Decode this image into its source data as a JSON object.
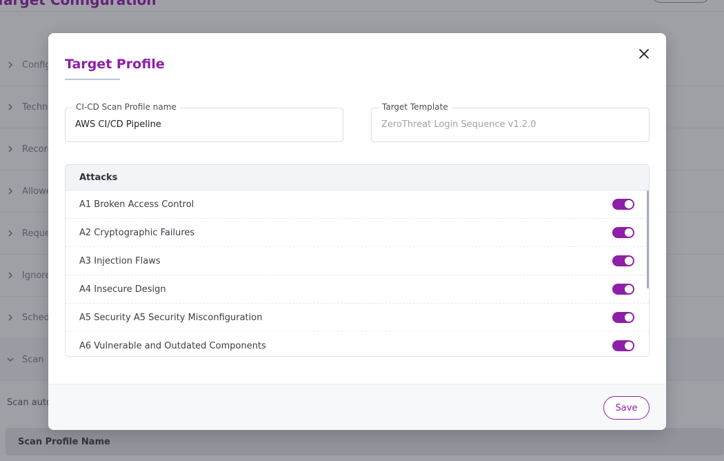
{
  "background": {
    "page_title": "Target Configuration",
    "sections": [
      {
        "label": "Configuration"
      },
      {
        "label": "Technology"
      },
      {
        "label": "Recorded Login"
      },
      {
        "label": "Allowed Hosts"
      },
      {
        "label": "Request Headers"
      },
      {
        "label": "Ignored URLs"
      },
      {
        "label": "Schedule"
      },
      {
        "label": "Scan"
      }
    ],
    "scan_subtext": "Scan automation",
    "table_header": "Scan Profile Name"
  },
  "modal": {
    "title": "Target Profile",
    "close_icon": "close-icon",
    "profile_name": {
      "label": "CI-CD Scan Profile name",
      "value": "AWS CI/CD Pipeline"
    },
    "target_template": {
      "label": "Target Template",
      "placeholder": "ZeroThreat Login Sequence v1.2.0"
    },
    "attacks": {
      "header": "Attacks",
      "items": [
        {
          "label": "A1 Broken Access Control",
          "enabled": true
        },
        {
          "label": "A2 Cryptographic Failures",
          "enabled": true
        },
        {
          "label": "A3 Injection Flaws",
          "enabled": true
        },
        {
          "label": "A4 Insecure Design",
          "enabled": true
        },
        {
          "label": "A5 Security A5 Security Misconfiguration",
          "enabled": true
        },
        {
          "label": "A6 Vulnerable and Outdated Components",
          "enabled": true
        }
      ]
    },
    "save_label": "Save"
  },
  "colors": {
    "accent": "#8e1fa7",
    "overlay": "rgba(40, 44, 56, 0.42)"
  }
}
